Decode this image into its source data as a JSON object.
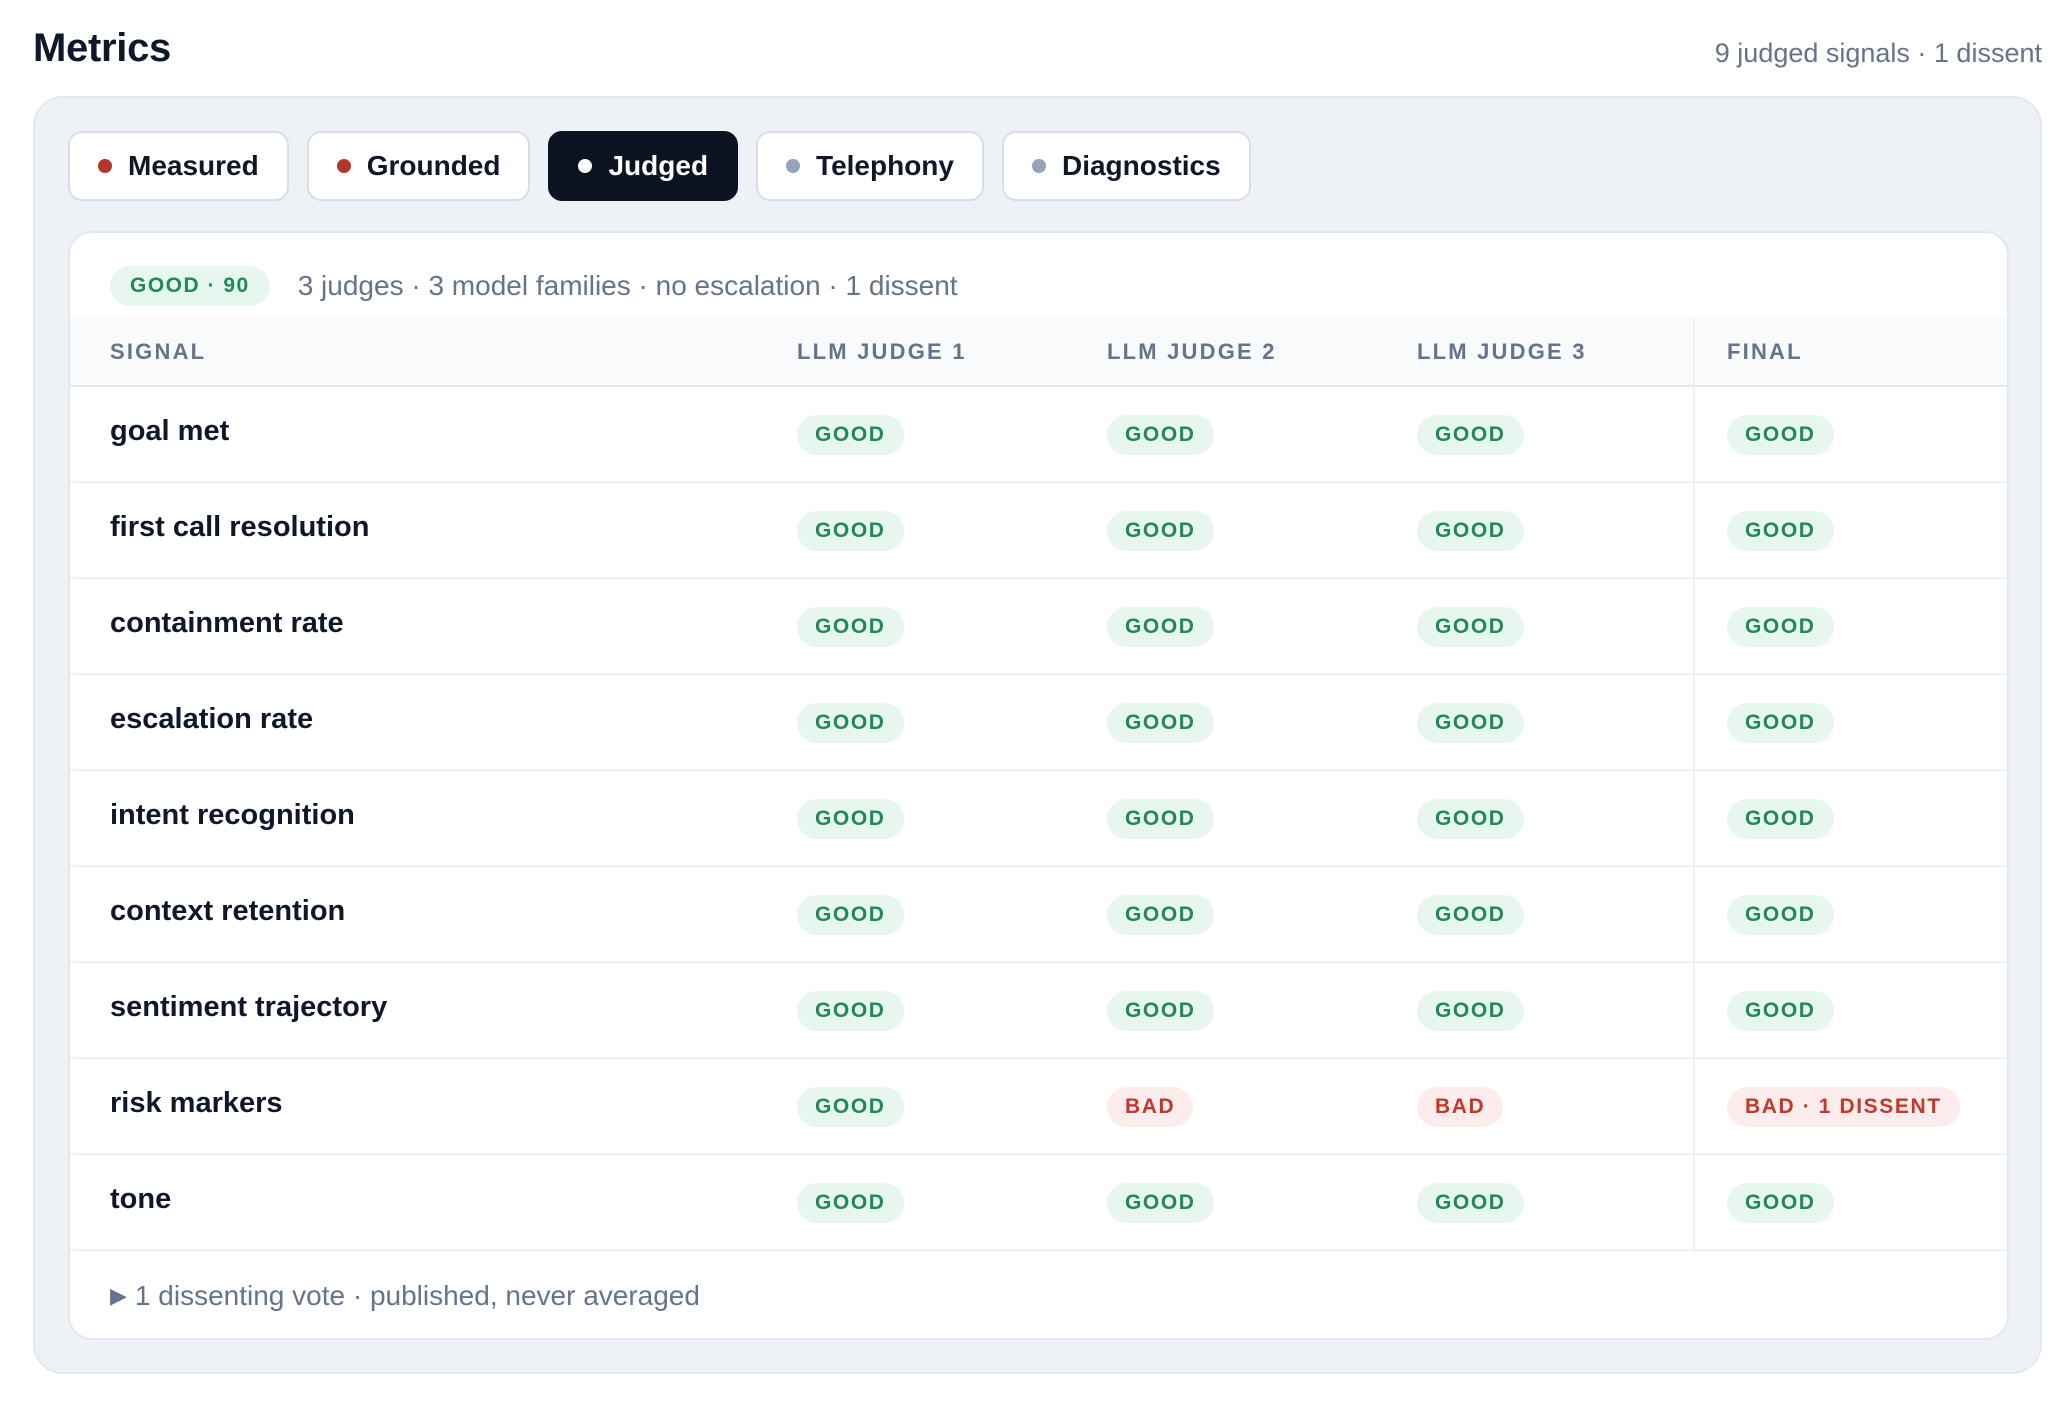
{
  "header": {
    "title": "Metrics",
    "summary": "9 judged signals · 1 dissent"
  },
  "tabs": [
    {
      "label": "Measured",
      "dot_color": "#b3362c",
      "active": false
    },
    {
      "label": "Grounded",
      "dot_color": "#b3362c",
      "active": false
    },
    {
      "label": "Judged",
      "dot_color": "#ffffff",
      "active": true
    },
    {
      "label": "Telephony",
      "dot_color": "#94a3b8",
      "active": false
    },
    {
      "label": "Diagnostics",
      "dot_color": "#94a3b8",
      "active": false
    }
  ],
  "summary": {
    "badge": "GOOD · 90",
    "text": "3 judges · 3 model families · no escalation · 1 dissent"
  },
  "table": {
    "columns": {
      "signal": "SIGNAL",
      "judge1": "LLM JUDGE 1",
      "judge2": "LLM JUDGE 2",
      "judge3": "LLM JUDGE 3",
      "final": "FINAL"
    },
    "rows": [
      {
        "signal": "goal met",
        "j1": "GOOD",
        "j2": "GOOD",
        "j3": "GOOD",
        "final": "GOOD"
      },
      {
        "signal": "first call resolution",
        "j1": "GOOD",
        "j2": "GOOD",
        "j3": "GOOD",
        "final": "GOOD"
      },
      {
        "signal": "containment rate",
        "j1": "GOOD",
        "j2": "GOOD",
        "j3": "GOOD",
        "final": "GOOD"
      },
      {
        "signal": "escalation rate",
        "j1": "GOOD",
        "j2": "GOOD",
        "j3": "GOOD",
        "final": "GOOD"
      },
      {
        "signal": "intent recognition",
        "j1": "GOOD",
        "j2": "GOOD",
        "j3": "GOOD",
        "final": "GOOD"
      },
      {
        "signal": "context retention",
        "j1": "GOOD",
        "j2": "GOOD",
        "j3": "GOOD",
        "final": "GOOD"
      },
      {
        "signal": "sentiment trajectory",
        "j1": "GOOD",
        "j2": "GOOD",
        "j3": "GOOD",
        "final": "GOOD"
      },
      {
        "signal": "risk markers",
        "j1": "GOOD",
        "j2": "BAD",
        "j3": "BAD",
        "final": "BAD · 1 DISSENT"
      },
      {
        "signal": "tone",
        "j1": "GOOD",
        "j2": "GOOD",
        "j3": "GOOD",
        "final": "GOOD"
      }
    ]
  },
  "footer": {
    "caret": "▶",
    "text": "1 dissenting vote · published, never averaged"
  },
  "colors": {
    "good_bg": "#e7f6ee",
    "good_fg": "#1f8a57",
    "bad_bg": "#fdecec",
    "bad_fg": "#c0392b"
  }
}
